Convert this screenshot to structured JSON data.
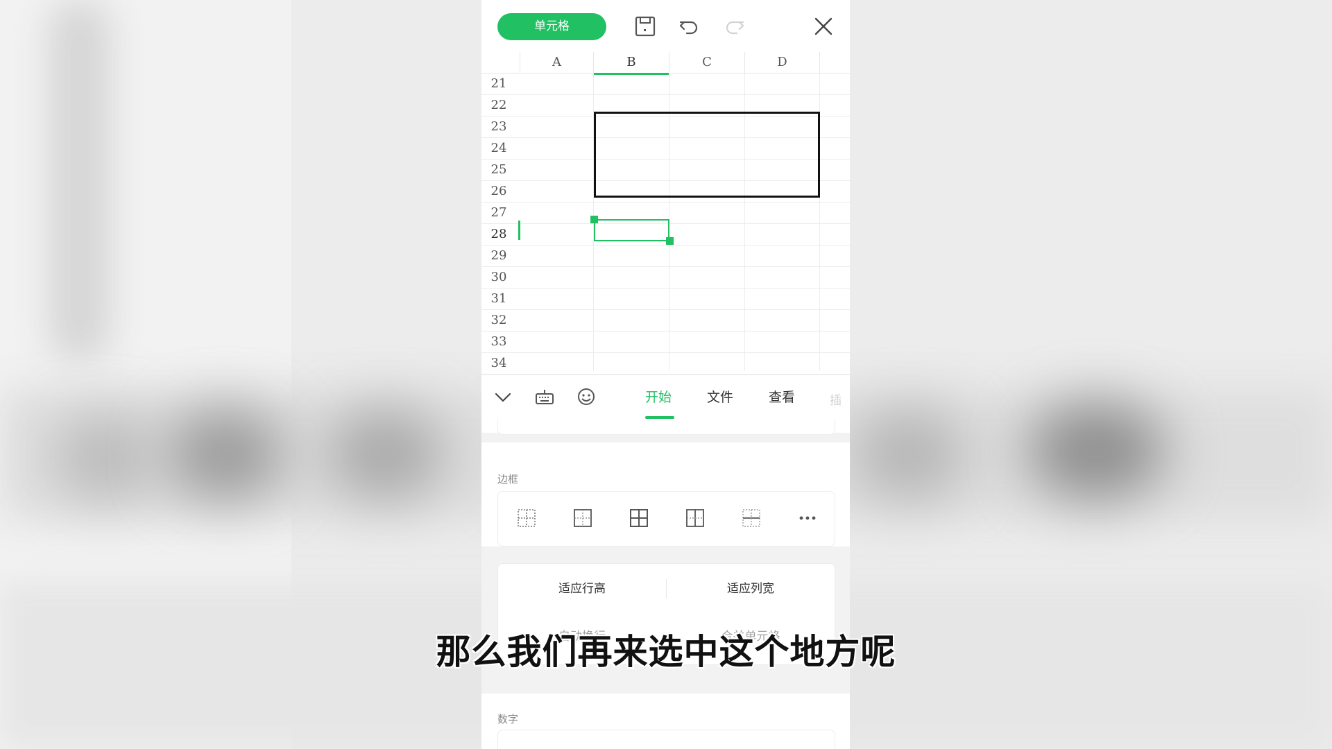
{
  "toolbar": {
    "cell_button_label": "单元格",
    "icons": [
      "save-icon",
      "undo-icon",
      "redo-icon",
      "close-icon"
    ]
  },
  "grid": {
    "columns": [
      "A",
      "B",
      "C",
      "D"
    ],
    "active_column": "B",
    "rows": [
      "21",
      "22",
      "23",
      "24",
      "25",
      "26",
      "27",
      "28",
      "29",
      "30",
      "31",
      "32",
      "33",
      "34"
    ],
    "active_row": "28",
    "bordered_range": "B23:D26",
    "selected_cell": "B28"
  },
  "tabbar": {
    "icons": [
      "collapse-chevron-icon",
      "keyboard-icon",
      "emoji-icon"
    ],
    "tabs": [
      "开始",
      "文件",
      "查看"
    ],
    "active_tab": "开始",
    "overflow_tab_fragment": "插"
  },
  "panel": {
    "border_section_label": "边框",
    "border_options": [
      "inner-dotted-border-icon",
      "inner-border-icon",
      "all-borders-icon",
      "vertical-inner-border-icon",
      "horizontal-inner-border-icon",
      "more-icon"
    ],
    "fit_row_height": "适应行高",
    "fit_column_width": "适应列宽",
    "hidden_row_left": "自动换行",
    "hidden_row_right": "合并单元格",
    "number_section_label": "数字"
  },
  "subtitle": "那么我们再来选中这个地方呢",
  "colors": {
    "accent": "#21c063",
    "border": "#111111"
  }
}
